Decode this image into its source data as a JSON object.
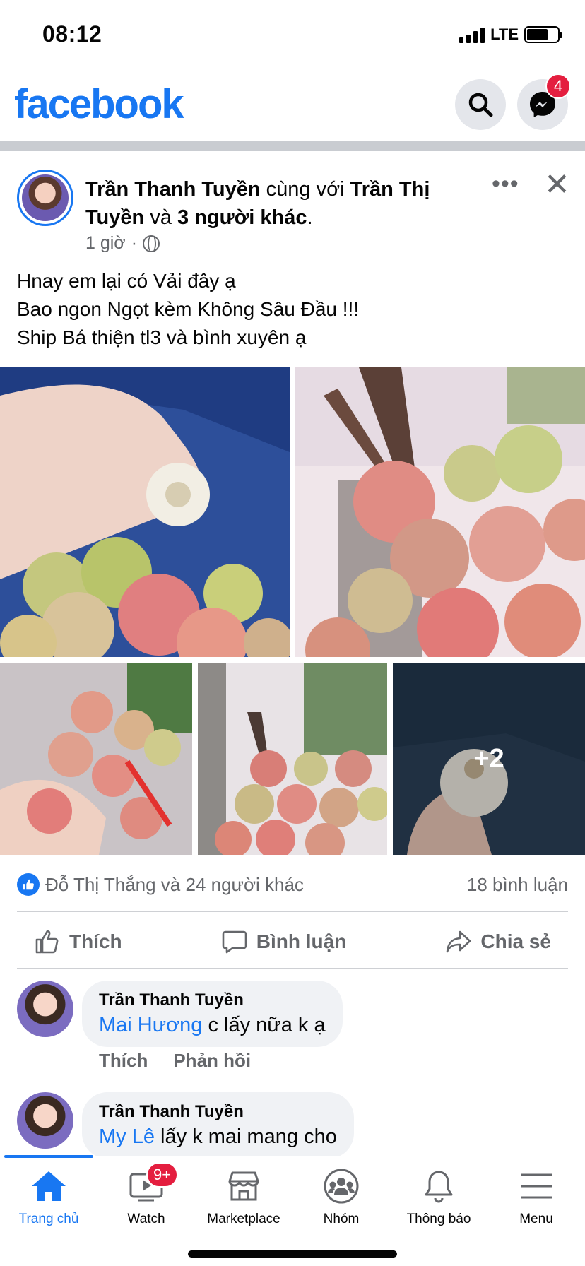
{
  "status_bar": {
    "time": "08:12",
    "network": "LTE"
  },
  "header": {
    "logo": "facebook",
    "messenger_badge": "4",
    "icons": [
      "search-icon",
      "messenger-icon"
    ]
  },
  "post": {
    "author": "Trần Thanh Tuyền",
    "with_text": "cùng với",
    "tagged": "Trần Thị Tuyền",
    "and_text": "và",
    "others": "3 người khác",
    "period": ".",
    "time": "1 giờ",
    "dot": "·",
    "privacy_icon": "globe-icon",
    "text": "Hnay em lại có Vải đây ạ\nBao ngon Ngọt kèm Không Sâu Đầu !!!\n Ship Bá thiện tl3 và bình xuyên ạ",
    "more_photos": "+2",
    "reactions_text": "Đỗ Thị Thắng và 24 người khác",
    "comments_count": "18 bình luận",
    "actions": {
      "like": "Thích",
      "comment": "Bình luận",
      "share": "Chia sẻ"
    }
  },
  "comments": [
    {
      "author": "Trần Thanh Tuyền",
      "mention": "Mai Hương",
      "text": " c lấy nữa k ạ",
      "like": "Thích",
      "reply": "Phản hồi"
    },
    {
      "author": "Trần Thanh Tuyền",
      "mention": "My Lê",
      "text": " lấy k mai mang cho"
    }
  ],
  "bottom_nav": {
    "home": "Trang chủ",
    "watch": "Watch",
    "watch_badge": "9+",
    "marketplace": "Marketplace",
    "groups": "Nhóm",
    "notifications": "Thông báo",
    "menu": "Menu"
  },
  "colors": {
    "brand": "#1877f2",
    "badge": "#e41e3f",
    "secondary_text": "#65676b"
  }
}
